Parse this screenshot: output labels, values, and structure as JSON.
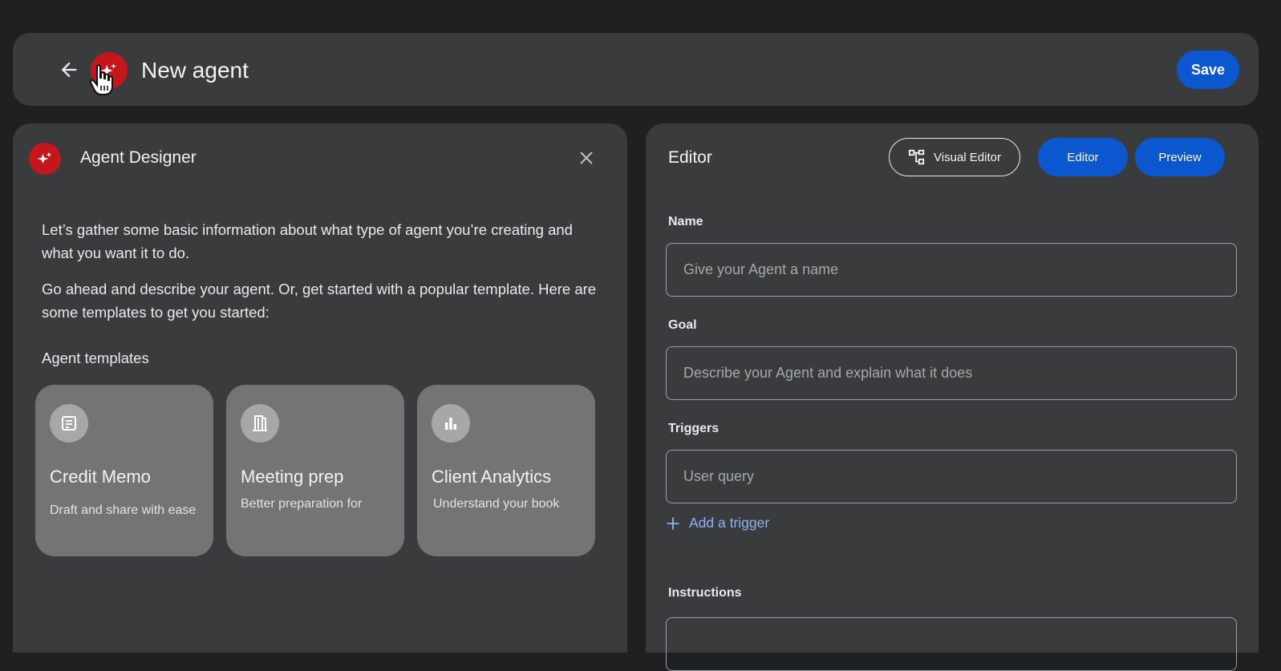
{
  "header": {
    "title": "New agent",
    "save_label": "Save",
    "back_icon": "arrow-left-icon",
    "avatar_icon": "sparkle-icon"
  },
  "designer": {
    "title": "Agent Designer",
    "intro_1": "Let’s gather some basic information about what type of agent you’re creating and what you want it to do.",
    "intro_2": "Go ahead and describe your agent. Or, get started with a popular template. Here are some templates to get you started:",
    "templates_heading": "Agent templates",
    "templates": [
      {
        "title": "Credit Memo",
        "description": "Draft and share with ease",
        "icon": "note-icon"
      },
      {
        "title": "Meeting prep",
        "description": "Better preparation for",
        "icon": "door-icon"
      },
      {
        "title": "Client Analytics",
        "description": "Understand your book",
        "icon": "bar-chart-icon"
      }
    ]
  },
  "editor": {
    "title": "Editor",
    "visual_editor_label": "Visual Editor",
    "editor_label": "Editor",
    "preview_label": "Preview",
    "fields": {
      "name": {
        "label": "Name",
        "placeholder": "Give your Agent a name"
      },
      "goal": {
        "label": "Goal",
        "placeholder": "Describe your Agent and explain what it does"
      },
      "triggers": {
        "label": "Triggers",
        "placeholder": "User query"
      },
      "instructions": {
        "label": "Instructions",
        "placeholder": ""
      }
    },
    "add_trigger_label": "Add a trigger"
  },
  "colors": {
    "background": "#1f2022",
    "panel": "#3a3b3d",
    "card": "#737474",
    "accent_blue": "#0b57d0",
    "link_blue": "#8ab4f8",
    "brand_red": "#c5161c"
  }
}
